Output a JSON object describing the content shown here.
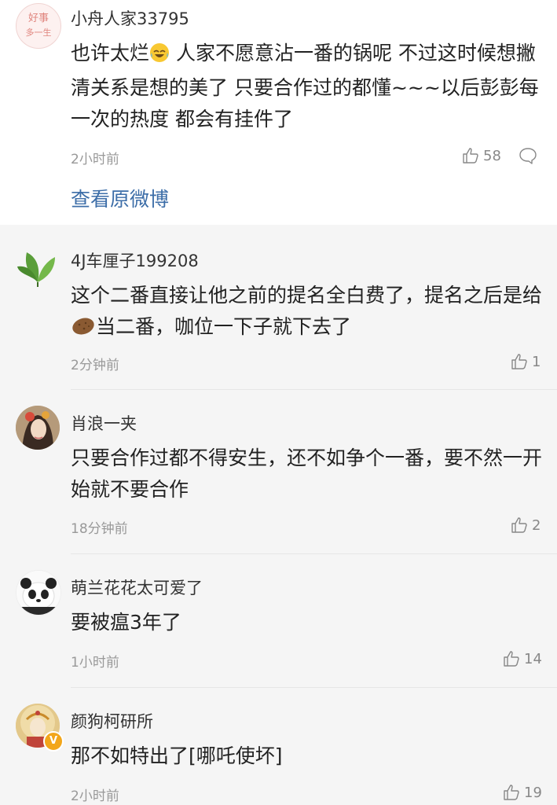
{
  "original_post": {
    "username": "小舟人家33795",
    "avatar_text": "好事多 一生",
    "text_before_emoji": "也许太烂",
    "emoji": "laughing-crying-emoji",
    "text_after_emoji": " 人家不愿意沾一番的锅呢 不过这时候想撇清关系是想的美了 只要合作过的都懂~~~以后彭彭每一次的热度 都会有挂件了",
    "time": "2小时前",
    "likes": "58",
    "view_link": "查看原微博"
  },
  "replies": [
    {
      "username": "4J车厘子199208",
      "text_before_emoji": "这个二番直接让他之前的提名全白费了，提名之后是给",
      "emoji": "potato-emoji",
      "text_after_emoji": "当二番，咖位一下子就下去了",
      "time": "2分钟前",
      "likes": "1"
    },
    {
      "username": "肖浪一夹",
      "text": "只要合作过都不得安生，还不如争个一番，要不然一开始就不要合作",
      "time": "18分钟前",
      "likes": "2"
    },
    {
      "username": "萌兰花花太可爱了",
      "text": "要被瘟3年了",
      "time": "1小时前",
      "likes": "14"
    },
    {
      "username": "颜狗柯研所",
      "text": "那不如特出了[哪吒使坏]",
      "time": "2小时前",
      "likes": "19",
      "badge": "V"
    }
  ],
  "colors": {
    "link": "#3d6ea8",
    "time": "#999999",
    "card_bg": "#ffffff",
    "page_bg": "#f5f5f5"
  }
}
